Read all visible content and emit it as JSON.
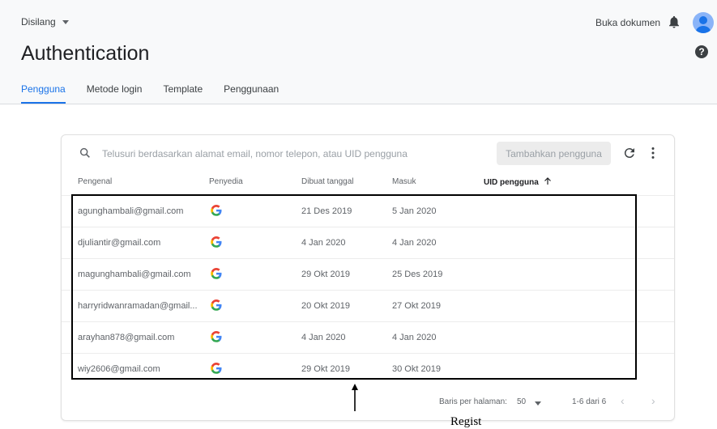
{
  "header": {
    "project": "Disilang",
    "docs_link": "Buka dokumen",
    "icons": {
      "project_caret": "chevron-down-icon",
      "notifications": "bell-icon",
      "account": "avatar-icon",
      "help": "help-icon"
    }
  },
  "page": {
    "title": "Authentication",
    "tabs": [
      {
        "label": "Pengguna",
        "active": true
      },
      {
        "label": "Metode login",
        "active": false
      },
      {
        "label": "Template",
        "active": false
      },
      {
        "label": "Penggunaan",
        "active": false
      }
    ]
  },
  "users_card": {
    "search_placeholder": "Telusuri berdasarkan alamat email, nomor telepon, atau UID pengguna",
    "add_user_label": "Tambahkan pengguna",
    "columns": {
      "identifier": "Pengenal",
      "provider": "Penyedia",
      "created": "Dibuat tanggal",
      "signed_in": "Masuk",
      "uid": "UID pengguna"
    },
    "rows": [
      {
        "email": "agunghambali@gmail.com",
        "created": "21 Des 2019",
        "signed_in": "5 Jan 2020",
        "provider_icon": "google-icon"
      },
      {
        "email": "djuliantir@gmail.com",
        "created": "4 Jan 2020",
        "signed_in": "4 Jan 2020",
        "provider_icon": "google-icon"
      },
      {
        "email": "magunghambali@gmail.com",
        "created": "29 Okt 2019",
        "signed_in": "25 Des 2019",
        "provider_icon": "google-icon"
      },
      {
        "email": "harryridwanramadan@gmail...",
        "created": "20 Okt 2019",
        "signed_in": "27 Okt 2019",
        "provider_icon": "google-icon"
      },
      {
        "email": "arayhan878@gmail.com",
        "created": "4 Jan 2020",
        "signed_in": "4 Jan 2020",
        "provider_icon": "google-icon"
      },
      {
        "email": "wiy2606@gmail.com",
        "created": "29 Okt 2019",
        "signed_in": "30 Okt 2019",
        "provider_icon": "google-icon"
      }
    ],
    "footer": {
      "rows_per_page_label": "Baris per halaman:",
      "rows_per_page_value": "50",
      "range": "1-6 dari 6"
    }
  },
  "annotation": {
    "caption": "Regist"
  },
  "colors": {
    "accent": "#1a73e8",
    "header_bg": "#f8f9fa",
    "google_blue": "#4285f4",
    "google_red": "#ea4335",
    "google_yellow": "#fbbc05",
    "google_green": "#34a853"
  }
}
